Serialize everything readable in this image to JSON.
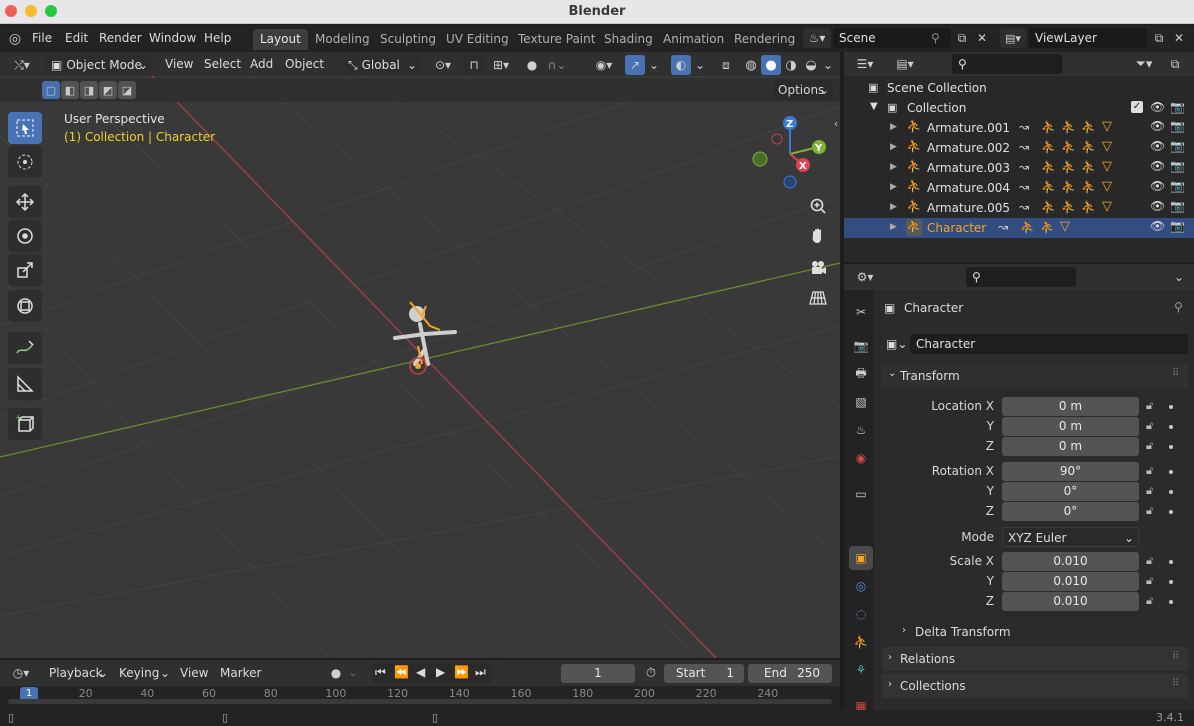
{
  "window": {
    "title": "Blender",
    "version": "3.4.1"
  },
  "menu": {
    "items": [
      "File",
      "Edit",
      "Render",
      "Window",
      "Help"
    ],
    "workspace_tabs": [
      "Layout",
      "Modeling",
      "Sculpting",
      "UV Editing",
      "Texture Paint",
      "Shading",
      "Animation",
      "Rendering"
    ],
    "active_tab": "Layout",
    "scene": "Scene",
    "view_layer": "ViewLayer"
  },
  "viewport_header": {
    "mode": "Object Mode",
    "menus": [
      "View",
      "Select",
      "Add",
      "Object"
    ],
    "orientation": "Global",
    "options_label": "Options"
  },
  "viewport": {
    "perspective_label": "User Perspective",
    "context_label": "(1) Collection | Character",
    "gizmo": {
      "z": "Z",
      "y": "Y",
      "x": "X"
    }
  },
  "outliner": {
    "root": "Scene Collection",
    "collection": "Collection",
    "items": [
      "Armature.001",
      "Armature.002",
      "Armature.003",
      "Armature.004",
      "Armature.005",
      "Character"
    ],
    "selected": "Character"
  },
  "properties": {
    "object_name": "Character",
    "data_name": "Character",
    "transform_title": "Transform",
    "location": {
      "label_x": "Location X",
      "label_y": "Y",
      "label_z": "Z",
      "x": "0 m",
      "y": "0 m",
      "z": "0 m"
    },
    "rotation": {
      "label_x": "Rotation X",
      "label_y": "Y",
      "label_z": "Z",
      "x": "90°",
      "y": "0°",
      "z": "0°"
    },
    "mode_label": "Mode",
    "mode_value": "XYZ Euler",
    "scale": {
      "label_x": "Scale X",
      "label_y": "Y",
      "label_z": "Z",
      "x": "0.010",
      "y": "0.010",
      "z": "0.010"
    },
    "delta_transform": "Delta Transform",
    "relations": "Relations",
    "collections": "Collections"
  },
  "timeline": {
    "menus": [
      "Playback",
      "Keying",
      "View",
      "Marker"
    ],
    "current_frame": "1",
    "start_label": "Start",
    "start_value": "1",
    "end_label": "End",
    "end_value": "250",
    "ruler": [
      "1",
      "20",
      "40",
      "60",
      "80",
      "100",
      "120",
      "140",
      "160",
      "180",
      "200",
      "220",
      "240"
    ]
  },
  "colors": {
    "accent": "#4772b3",
    "selected_orange": "#f5a623",
    "green": "#5fb432",
    "teal": "#31c1a3"
  }
}
